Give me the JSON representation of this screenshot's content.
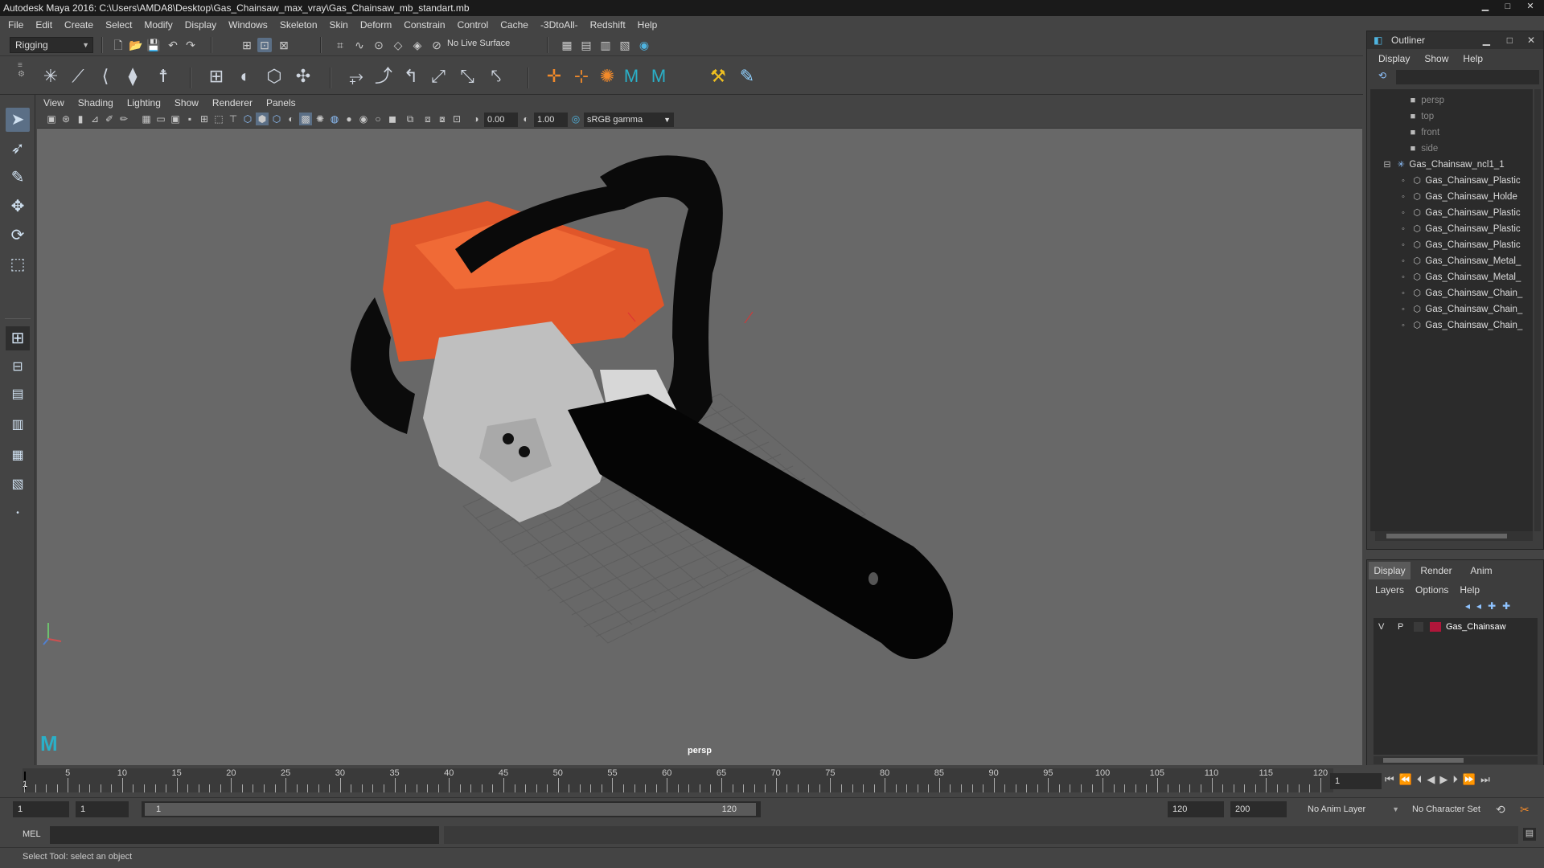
{
  "window": {
    "title": "Autodesk Maya 2016: C:\\Users\\AMDA8\\Desktop\\Gas_Chainsaw_max_vray\\Gas_Chainsaw_mb_standart.mb",
    "minimize": "▁",
    "maximize": "□",
    "close": "✕"
  },
  "menubar": [
    "File",
    "Edit",
    "Create",
    "Select",
    "Modify",
    "Display",
    "Windows",
    "Skeleton",
    "Skin",
    "Deform",
    "Constrain",
    "Control",
    "Cache",
    "-3DtoAll-",
    "Redshift",
    "Help"
  ],
  "statusline": {
    "menuset": "Rigging",
    "live_surface": "No Live Surface"
  },
  "viewport": {
    "menu": [
      "View",
      "Shading",
      "Lighting",
      "Show",
      "Renderer",
      "Panels"
    ],
    "exposure": "0.00",
    "gamma": "1.00",
    "colorspace": "sRGB gamma",
    "camera": "persp"
  },
  "outliner": {
    "title": "Outliner",
    "menu": [
      "Display",
      "Show",
      "Help"
    ],
    "cameras": [
      "persp",
      "top",
      "front",
      "side"
    ],
    "group": "Gas_Chainsaw_ncl1_1",
    "children": [
      "Gas_Chainsaw_Plastic",
      "Gas_Chainsaw_Holde",
      "Gas_Chainsaw_Plastic",
      "Gas_Chainsaw_Plastic",
      "Gas_Chainsaw_Plastic",
      "Gas_Chainsaw_Metal_",
      "Gas_Chainsaw_Metal_",
      "Gas_Chainsaw_Chain_",
      "Gas_Chainsaw_Chain_",
      "Gas_Chainsaw_Chain_"
    ]
  },
  "layers": {
    "tabs": [
      "Display",
      "Render",
      "Anim"
    ],
    "menu": [
      "Layers",
      "Options",
      "Help"
    ],
    "row": {
      "v": "V",
      "p": "P",
      "name": "Gas_Chainsaw",
      "color": "#b0163a"
    }
  },
  "timeline": {
    "ticks": [
      "5",
      "10",
      "15",
      "20",
      "25",
      "30",
      "35",
      "40",
      "45",
      "50",
      "55",
      "60",
      "65",
      "70",
      "75",
      "80",
      "85",
      "90",
      "95",
      "100",
      "105",
      "110",
      "115",
      "120"
    ],
    "first": "1",
    "current_frame": "1"
  },
  "range": {
    "start": "1",
    "playback_start": "1",
    "slider_start": "1",
    "slider_end": "120",
    "playback_end": "120",
    "end": "200",
    "anim_layer": "No Anim Layer",
    "character_set": "No Character Set"
  },
  "command": {
    "label": "MEL"
  },
  "help_line": "Select Tool: select an object"
}
